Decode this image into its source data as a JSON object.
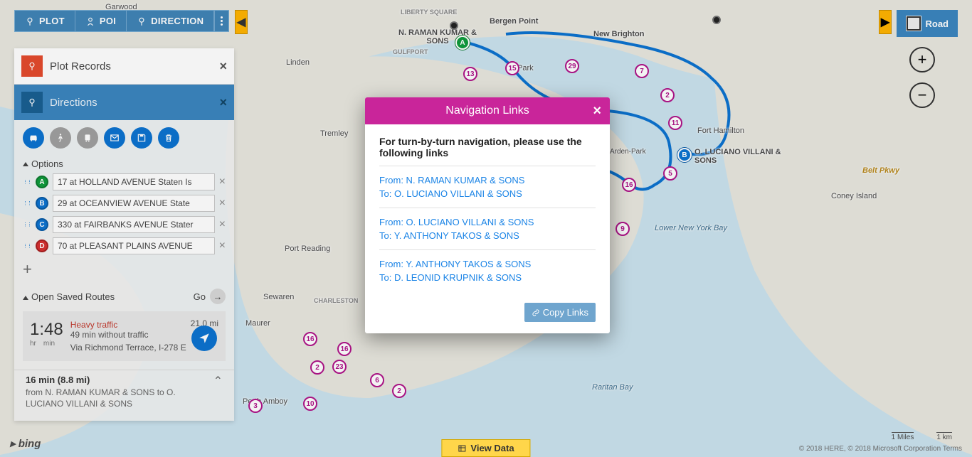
{
  "toolbar": {
    "plot": "PLOT",
    "poi": "POI",
    "direction": "DIRECTION"
  },
  "map_type": {
    "label": "Road"
  },
  "panel": {
    "plot_records": {
      "title": "Plot Records"
    },
    "directions": {
      "title": "Directions",
      "options_label": "Options",
      "stops": {
        "A": "17 at HOLLAND AVENUE Staten Is",
        "B": "29 at OCEANVIEW AVENUE State",
        "C": "330 at FAIRBANKS AVENUE Stater",
        "D": "70 at PLEASANT PLAINS AVENUE"
      },
      "saved_label": "Open Saved Routes",
      "go_label": "Go",
      "route": {
        "time_main": "1:48",
        "time_hr": "hr",
        "time_min": "min",
        "traffic": "Heavy traffic",
        "no_traffic": "49 min without traffic",
        "via": "Via Richmond Terrace, I-278 E",
        "distance": "21.0 mi"
      },
      "segment": {
        "summary": "16 min (8.8 mi)",
        "desc": "from N. RAMAN KUMAR & SONS to O. LUCIANO VILLANI & SONS"
      }
    }
  },
  "modal": {
    "title": "Navigation Links",
    "msg": "For turn-by-turn navigation, please use the following links",
    "links": [
      {
        "from": "From: N. RAMAN KUMAR & SONS",
        "to": "To: O. LUCIANO VILLANI & SONS"
      },
      {
        "from": "From: O. LUCIANO VILLANI & SONS",
        "to": "To: Y. ANTHONY TAKOS & SONS"
      },
      {
        "from": "From: Y. ANTHONY TAKOS & SONS",
        "to": "To: D. LEONID KRUPNIK & SONS"
      }
    ],
    "copy": "Copy Links"
  },
  "map_labels": {
    "raman": "N. RAMAN KUMAR & SONS",
    "luciano": "O. LUCIANO VILLANI & SONS",
    "bergen": "Bergen Point",
    "newb": "New Brighton",
    "forth": "Fort Hamilton",
    "lnyb": "Lower New York Bay",
    "rbay": "Raritan Bay",
    "coney": "Coney Island",
    "belt": "Belt Pkwy",
    "garwood": "Garwood",
    "linden": "Linden",
    "tremley": "Tremley",
    "portr": "Port Reading",
    "sewaren": "Sewaren",
    "maurer": "Maurer",
    "pamboy": "Perth Amboy",
    "charleston": "CHARLESTON",
    "gulfport": "GULFPORT",
    "liberty": "LIBERTY SQUARE",
    "arden": "Arden-Park",
    "park": "Park"
  },
  "bottom": {
    "view_data": "View Data",
    "bing": "bing",
    "copyright": "© 2018 HERE, © 2018 Microsoft Corporation  Terms",
    "scale_mi": "1 Miles",
    "scale_km": "1 km"
  },
  "pins": [
    "13",
    "15",
    "29",
    "7",
    "2",
    "11",
    "5",
    "16",
    "9",
    "2",
    "6",
    "16",
    "23",
    "10",
    "2",
    "16",
    "3"
  ]
}
